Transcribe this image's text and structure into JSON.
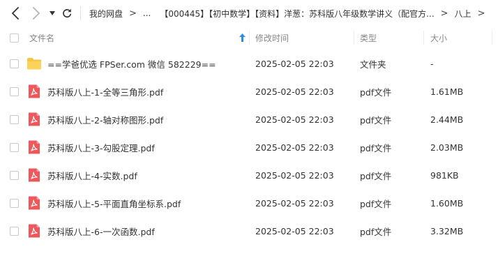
{
  "nav": {
    "back_icon": "chevron-left-icon",
    "forward_icon": "chevron-right-icon",
    "dropdown_icon": "caret-down-icon",
    "refresh_icon": "refresh-icon"
  },
  "breadcrumb": {
    "root": "我的网盘",
    "sep": ">",
    "ellipsis": "...",
    "folder": "【000445】【初中数学】【资料】洋葱：苏科版八年级数学讲义（配官方...",
    "current": "八上"
  },
  "table": {
    "headers": {
      "name": "文件名",
      "modified": "修改时间",
      "type": "类型",
      "size": "大小"
    },
    "sort_icon": "sort-ascending-arrow-icon",
    "rows": [
      {
        "icon": "folder-icon",
        "name": "==学爸优选 FPSer.com 微信 582229==",
        "modified": "2025-02-05 22:03",
        "type": "文件夹",
        "size": "-"
      },
      {
        "icon": "pdf-icon",
        "name": "苏科版八上-1-全等三角形.pdf",
        "modified": "2025-02-05 22:03",
        "type": "pdf文件",
        "size": "1.61MB"
      },
      {
        "icon": "pdf-icon",
        "name": "苏科版八上-2-轴对称图形.pdf",
        "modified": "2025-02-05 22:03",
        "type": "pdf文件",
        "size": "2.44MB"
      },
      {
        "icon": "pdf-icon",
        "name": "苏科版八上-3-勾股定理.pdf",
        "modified": "2025-02-05 22:03",
        "type": "pdf文件",
        "size": "2.03MB"
      },
      {
        "icon": "pdf-icon",
        "name": "苏科版八上-4-实数.pdf",
        "modified": "2025-02-05 22:03",
        "type": "pdf文件",
        "size": "981KB"
      },
      {
        "icon": "pdf-icon",
        "name": "苏科版八上-5-平面直角坐标系.pdf",
        "modified": "2025-02-05 22:03",
        "type": "pdf文件",
        "size": "1.60MB"
      },
      {
        "icon": "pdf-icon",
        "name": "苏科版八上-6-一次函数.pdf",
        "modified": "2025-02-05 22:03",
        "type": "pdf文件",
        "size": "3.32MB"
      }
    ]
  },
  "colors": {
    "folder": "#f7c544",
    "pdf": "#f0575a",
    "sort_arrow": "#2b8cf0",
    "header_text": "#888888"
  }
}
